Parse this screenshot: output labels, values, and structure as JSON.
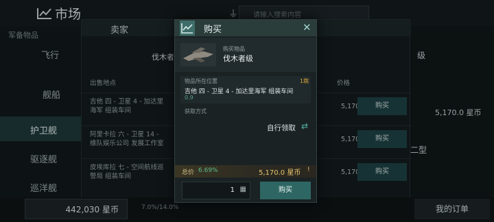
{
  "market": {
    "title": "市场",
    "search_placeholder": "请输入搜索内容",
    "section_label": "军备物品",
    "categories": [
      {
        "label": "飞行"
      },
      {
        "label": "舰船"
      },
      {
        "label": "护卫舰",
        "active": true
      },
      {
        "label": "驱逐舰"
      },
      {
        "label": "巡洋舰"
      }
    ]
  },
  "seller": {
    "title": "卖家",
    "item_name": "伐木者",
    "col_location": "出售地点",
    "col_price": "价格",
    "rows": [
      {
        "location": "吉他 四 - 卫星 4 - 加达里海军 组装车间",
        "price": "5,170.0",
        "buy": "购买"
      },
      {
        "location": "阿里卡拉 六 - 卫星 14 - 维队娱乐公司 发展工作室",
        "price": "5,170.0",
        "buy": "购买"
      },
      {
        "location": "皮埃库拉 七 - 空间航线巡警局 组装车间",
        "price": "5,170.0",
        "buy": "购买"
      }
    ]
  },
  "right_panel": {
    "level_label": "级",
    "price": "5,170.0 星币",
    "type_label": "二型"
  },
  "bottom": {
    "balance": "442,030 星币",
    "pct": "7.0%/14.0%",
    "orders": "我的订单"
  },
  "dialog": {
    "title": "购买",
    "item_caption": "购买物品",
    "item_name": "伐木者级",
    "location_caption": "物品所在位置",
    "jumps": "1跳",
    "location_name": "吉他 四 - 卫星 4 - 加达里海军 组装车间",
    "security": "0.9",
    "acquire_caption": "获取方式",
    "acquire_value": "自行领取",
    "total_label": "总价",
    "total_pct": "6.69%",
    "total_amount": "5,170.0 星币",
    "quantity": "1",
    "buy_label": "购买"
  }
}
